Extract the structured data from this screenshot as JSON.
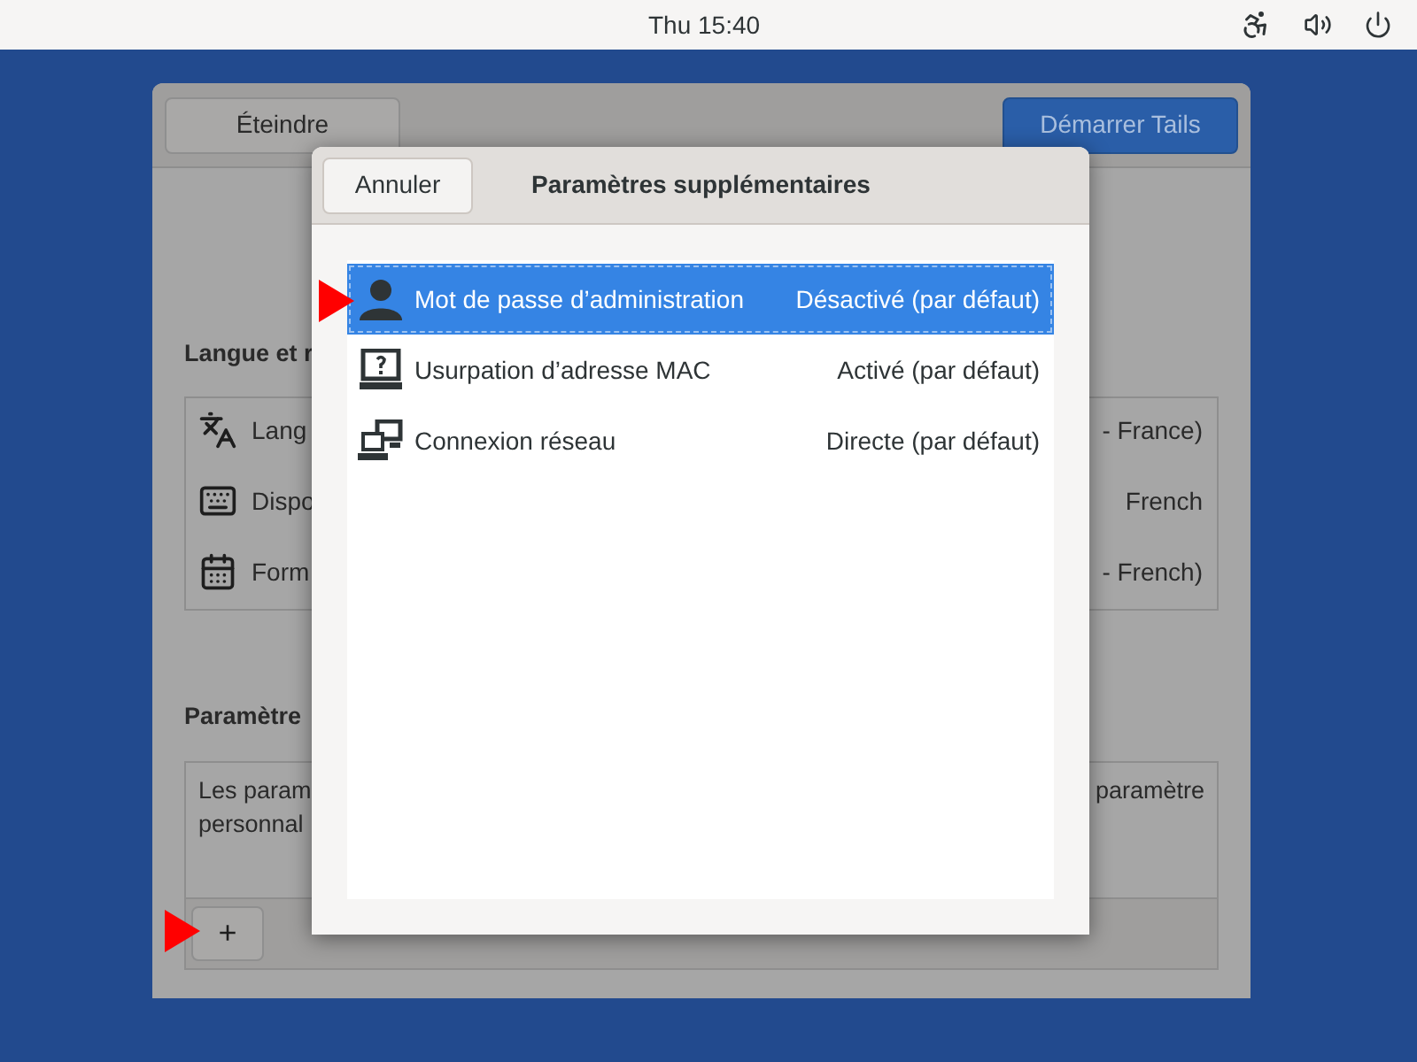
{
  "top_bar": {
    "clock": "Thu 15:40"
  },
  "window": {
    "shutdown_button": "Éteindre",
    "start_button": "Démarrer Tails",
    "language_section": {
      "title": "Langue et r",
      "rows": [
        {
          "kind": "language",
          "label": "Lang",
          "value": "- France)"
        },
        {
          "kind": "keyboard",
          "label": "Dispo",
          "value": "French"
        },
        {
          "kind": "formats",
          "label": "Form",
          "value": "- French)"
        }
      ]
    },
    "additional_section": {
      "title": "Paramètre",
      "text_left": [
        "Les param",
        "personnal"
      ],
      "text_right": [
        "paramètre"
      ],
      "add_button": "+"
    }
  },
  "dialog": {
    "cancel_button": "Annuler",
    "title": "Paramètres supplémentaires",
    "settings": [
      {
        "kind": "admin",
        "label": "Mot de passe d’administration",
        "value": "Désactivé (par défaut)",
        "selected": true
      },
      {
        "kind": "mac",
        "label": "Usurpation d’adresse MAC",
        "value": "Activé (par défaut)",
        "selected": false
      },
      {
        "kind": "network",
        "label": "Connexion réseau",
        "value": "Directe (par défaut)",
        "selected": false
      }
    ]
  }
}
